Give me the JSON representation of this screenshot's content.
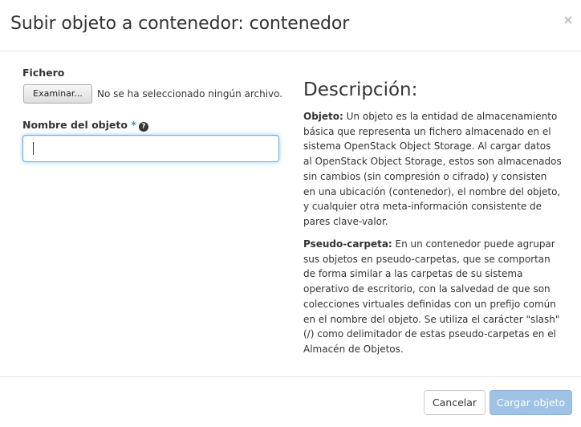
{
  "dialog": {
    "title": "Subir objeto a contenedor: contenedor",
    "close_glyph": "×"
  },
  "form": {
    "file_label": "Fichero",
    "browse_label": "Examinar...",
    "no_file_text": "No se ha seleccionado ningún archivo.",
    "object_name_label": "Nombre del objeto",
    "required_marker": "*",
    "help_glyph": "?",
    "object_name_value": ""
  },
  "description": {
    "heading": "Descripción:",
    "object_term": "Objeto:",
    "object_text": " Un objeto es la entidad de almacenamiento básica que representa un fichero almacenado en el sistema OpenStack Object Storage. Al cargar datos al OpenStack Object Storage, estos son almacenados sin cambios (sin compresión o cifrado) y consisten en una ubicación (contenedor), el nombre del objeto, y cualquier otra meta-información consistente de pares clave-valor.",
    "pseudo_term": "Pseudo-carpeta:",
    "pseudo_text": " En un contenedor puede agrupar sus objetos en pseudo-carpetas, que se comportan de forma similar a las carpetas de su sistema operativo de escritorio, con la salvedad de que son colecciones virtuales definidas con un prefijo común en el nombre del objeto. Se utiliza el carácter \"slash\" (/) como delimitador de estas pseudo-carpetas en el Almacén de Objetos."
  },
  "footer": {
    "cancel_label": "Cancelar",
    "submit_label": "Cargar objeto"
  },
  "colors": {
    "accent": "#66afe9",
    "submit_disabled": "#9ec3e6",
    "required": "#428bca"
  }
}
